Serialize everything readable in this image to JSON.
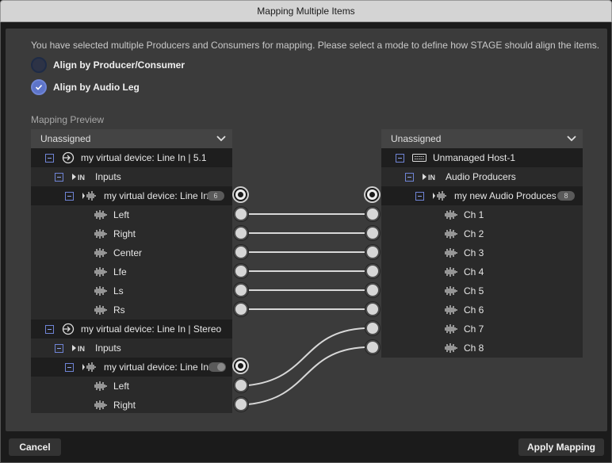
{
  "window": {
    "title": "Mapping Multiple Items"
  },
  "intro_text": "You have selected multiple Producers and Consumers for mapping. Please select a mode to define how STAGE should align the items.",
  "modes": [
    {
      "label": "Align by Producer/Consumer",
      "selected": false
    },
    {
      "label": "Align by Audio Leg",
      "selected": true
    }
  ],
  "preview_label": "Mapping Preview",
  "left_tree": {
    "header": "Unassigned",
    "device1": {
      "name": "my virtual device: Line In | 5.1",
      "inputs_label": "Inputs",
      "stream": "my virtual device: Line In...",
      "stream_count": "6",
      "channels": [
        "Left",
        "Right",
        "Center",
        "Lfe",
        "Ls",
        "Rs"
      ]
    },
    "device2": {
      "name": "my virtual device: Line In | Stereo",
      "inputs_label": "Inputs",
      "stream": "my virtual device: Line In...",
      "channels": [
        "Left",
        "Right"
      ]
    }
  },
  "right_tree": {
    "header": "Unassigned",
    "host": "Unmanaged Host-1",
    "group": "Audio Producers",
    "stream": "my new Audio Produces",
    "stream_count": "8",
    "channels": [
      "Ch 1",
      "Ch 2",
      "Ch 3",
      "Ch 4",
      "Ch 5",
      "Ch 6",
      "Ch 7",
      "Ch 8"
    ]
  },
  "footer": {
    "cancel": "Cancel",
    "apply": "Apply Mapping"
  },
  "colors": {
    "accent": "#5d74c9",
    "link": "#d8d8d8"
  },
  "icons": {
    "device": "arrow-into-circle-icon",
    "inputs": "play-in-icon",
    "stream": "waveform-icon",
    "host": "keyboard-icon",
    "collapse": "chevron-down-icon",
    "selected": "checkmark-icon"
  }
}
